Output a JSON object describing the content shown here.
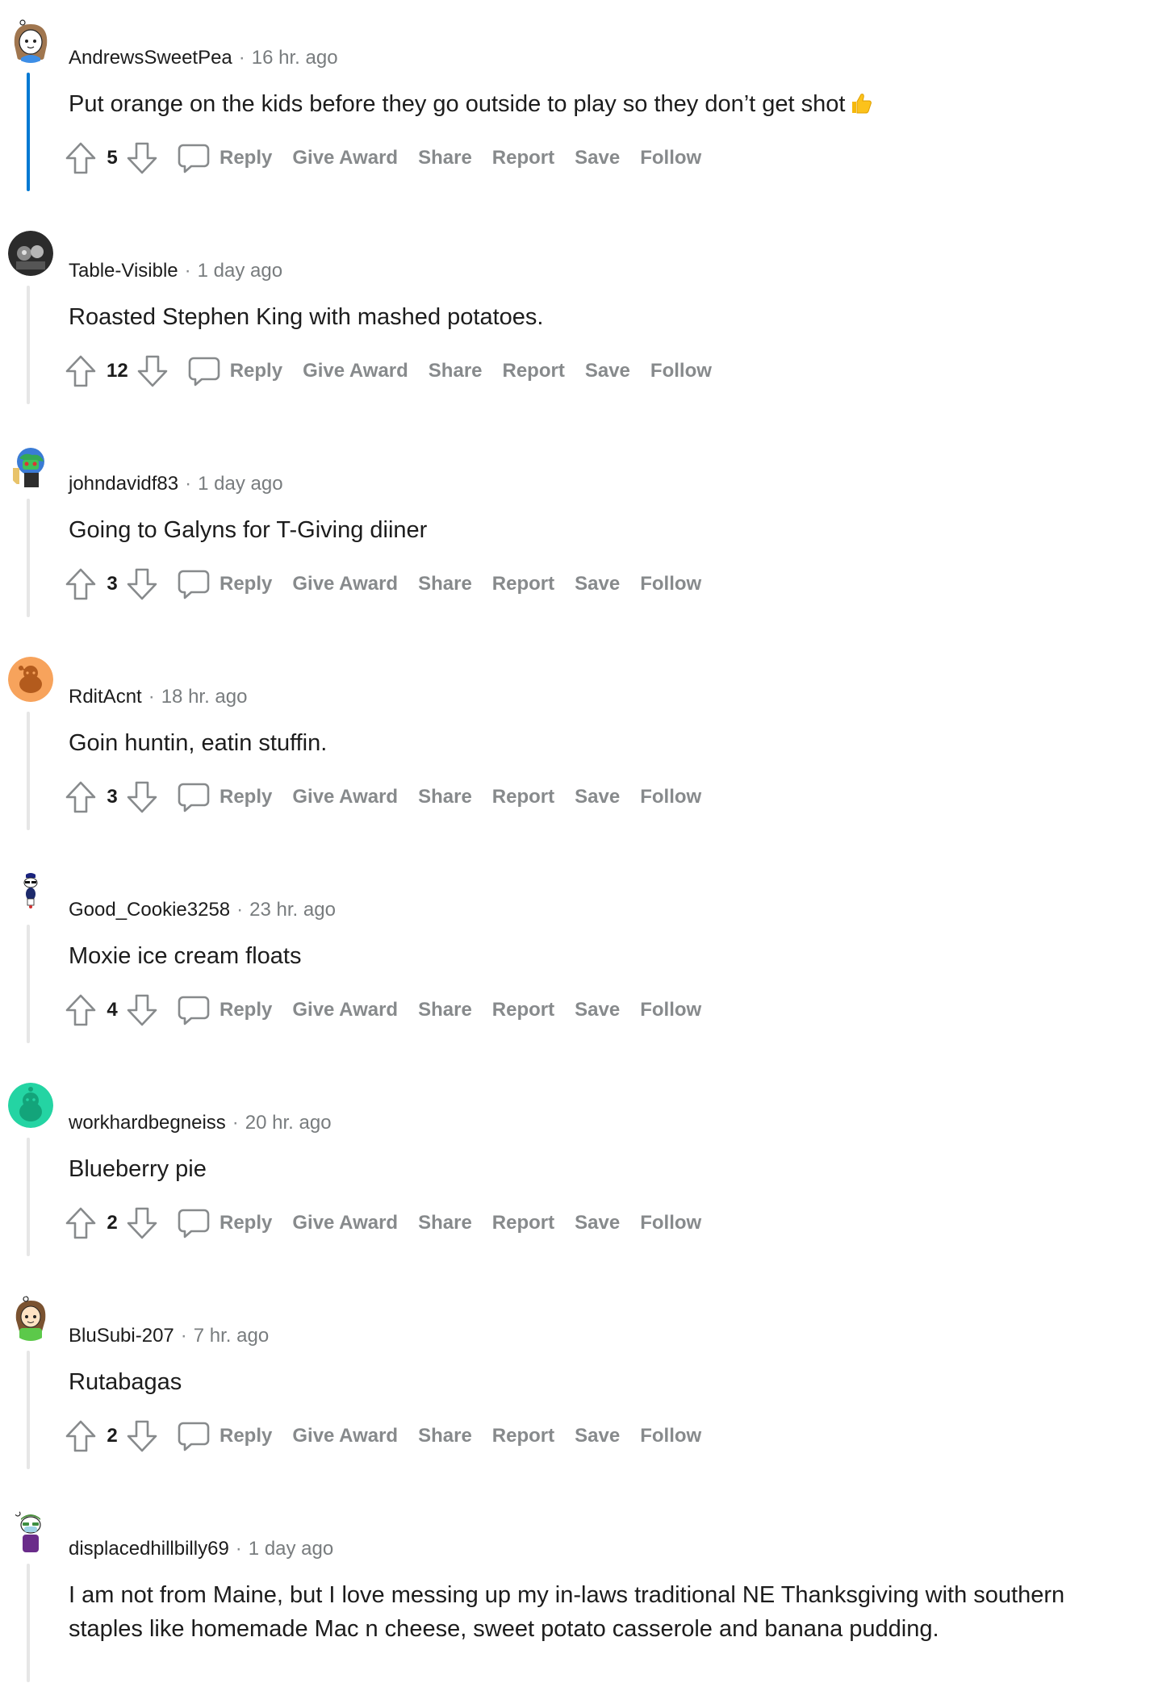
{
  "action_labels": {
    "reply": "Reply",
    "give_award": "Give Award",
    "share": "Share",
    "report": "Report",
    "save": "Save",
    "follow": "Follow"
  },
  "colors": {
    "active_thread": "#0079d3",
    "thread": "#e6e6e6",
    "muted": "#878a8c"
  },
  "comments": [
    {
      "username": "AndrewsSweetPea",
      "time": "16 hr. ago",
      "body": "Put orange on the kids before they go outside to play so they don’t get shot",
      "emoji": "thumbs-up-icon",
      "votes": "5",
      "avatar": "girl-avatar-icon",
      "active": true
    },
    {
      "username": "Table-Visible",
      "time": "1 day ago",
      "body": "Roasted Stephen King with mashed potatoes.",
      "votes": "12",
      "avatar": "photo-avatar-icon"
    },
    {
      "username": "johndavidf83",
      "time": "1 day ago",
      "body": "Going to Galyns for T-Giving diiner",
      "votes": "3",
      "avatar": "robot-avatar-icon"
    },
    {
      "username": "RditAcnt",
      "time": "18 hr. ago",
      "body": "Goin huntin, eatin stuffin.",
      "votes": "3",
      "avatar": "default-orange-avatar-icon"
    },
    {
      "username": "Good_Cookie3258",
      "time": "23 hr. ago",
      "body": "Moxie ice cream floats",
      "votes": "4",
      "avatar": "snoo-sunglasses-avatar-icon"
    },
    {
      "username": "workhardbegneiss",
      "time": "20 hr. ago",
      "body": "Blueberry pie",
      "votes": "2",
      "avatar": "default-teal-avatar-icon"
    },
    {
      "username": "BluSubi-207",
      "time": "7 hr. ago",
      "body": "Rutabagas",
      "votes": "2",
      "avatar": "girl-green-avatar-icon"
    },
    {
      "username": "displacedhillbilly69",
      "time": "1 day ago",
      "body": "I am not from Maine, but I love messing up my in-laws traditional NE Thanksgiving with southern staples like homemade Mac n cheese, sweet potato casserole and banana pudding.",
      "votes": "",
      "avatar": "snoo-mask-avatar-icon"
    }
  ]
}
